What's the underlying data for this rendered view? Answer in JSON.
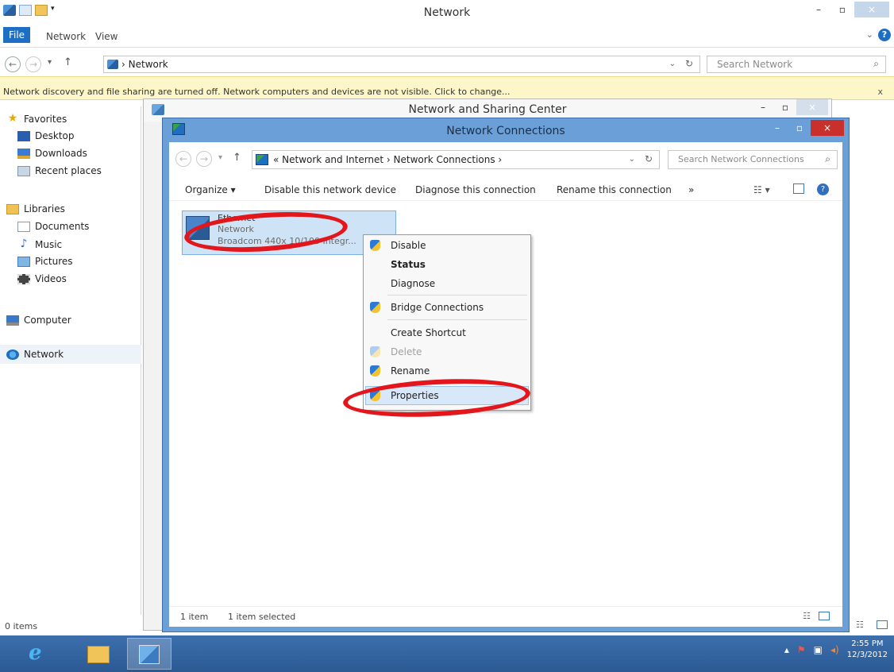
{
  "outer": {
    "title": "Network",
    "menu": [
      "File",
      "Network",
      "View"
    ],
    "address": "Network",
    "search_placeholder": "Search Network",
    "infobar": "Network discovery and file sharing are turned off. Network computers and devices are not visible. Click to change...",
    "nav": {
      "favorites": "Favorites",
      "desktop": "Desktop",
      "downloads": "Downloads",
      "recent": "Recent places",
      "libraries": "Libraries",
      "documents": "Documents",
      "music": "Music",
      "pictures": "Pictures",
      "videos": "Videos",
      "computer": "Computer",
      "network": "Network"
    },
    "status": "0 items"
  },
  "nsc": {
    "title": "Network and Sharing Center"
  },
  "nc": {
    "title": "Network Connections",
    "address_path": "« Network and Internet › Network Connections ›",
    "search_placeholder": "Search Network Connections",
    "commands": [
      "Organize ▾",
      "Disable this network device",
      "Diagnose this connection",
      "Rename this connection",
      "»"
    ],
    "item": {
      "name": "Ethernet",
      "status": "Network",
      "device": "Broadcom 440x 10/100 Integr..."
    },
    "context_menu": [
      "Disable",
      "Status",
      "Diagnose",
      "Bridge Connections",
      "Create Shortcut",
      "Delete",
      "Rename",
      "Properties"
    ],
    "status_items": "1 item",
    "status_selected": "1 item selected"
  },
  "taskbar": {
    "time": "2:55 PM",
    "date": "12/3/2012"
  },
  "colors": {
    "accent": "#1e6fc4",
    "titlebar_active": "#6a9fd8",
    "close_red": "#c9302c",
    "highlight_ring": "#e3161b",
    "infobar": "#fdf6c8"
  }
}
